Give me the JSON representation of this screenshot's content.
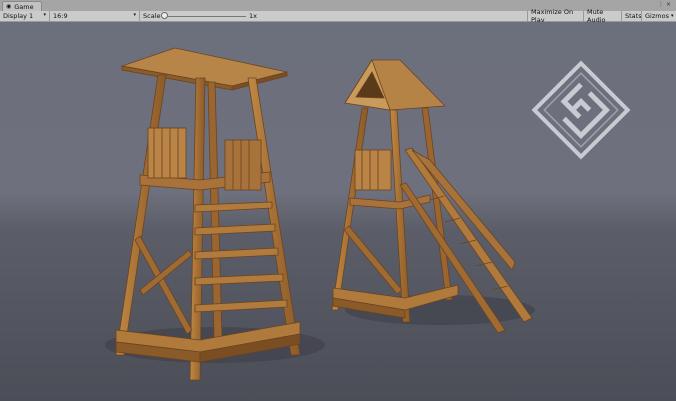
{
  "window": {
    "tab_title": "Game",
    "icons": [
      "game-icon",
      "menu-icon",
      "close-icon"
    ]
  },
  "toolbar": {
    "display": "Display 1",
    "aspect": "16:9",
    "scale_label": "Scale",
    "scale_value": "1x",
    "scale_fraction": 0.0,
    "maximize_on_play": "Maximize On Play",
    "mute_audio": "Mute Audio",
    "stats": "Stats",
    "gizmos": "Gizmos"
  },
  "colors": {
    "background_top": "#6c6f7c",
    "background_bottom": "#4b4d57",
    "wood": "#b07a3c",
    "wood_dark": "#7a4e22"
  }
}
